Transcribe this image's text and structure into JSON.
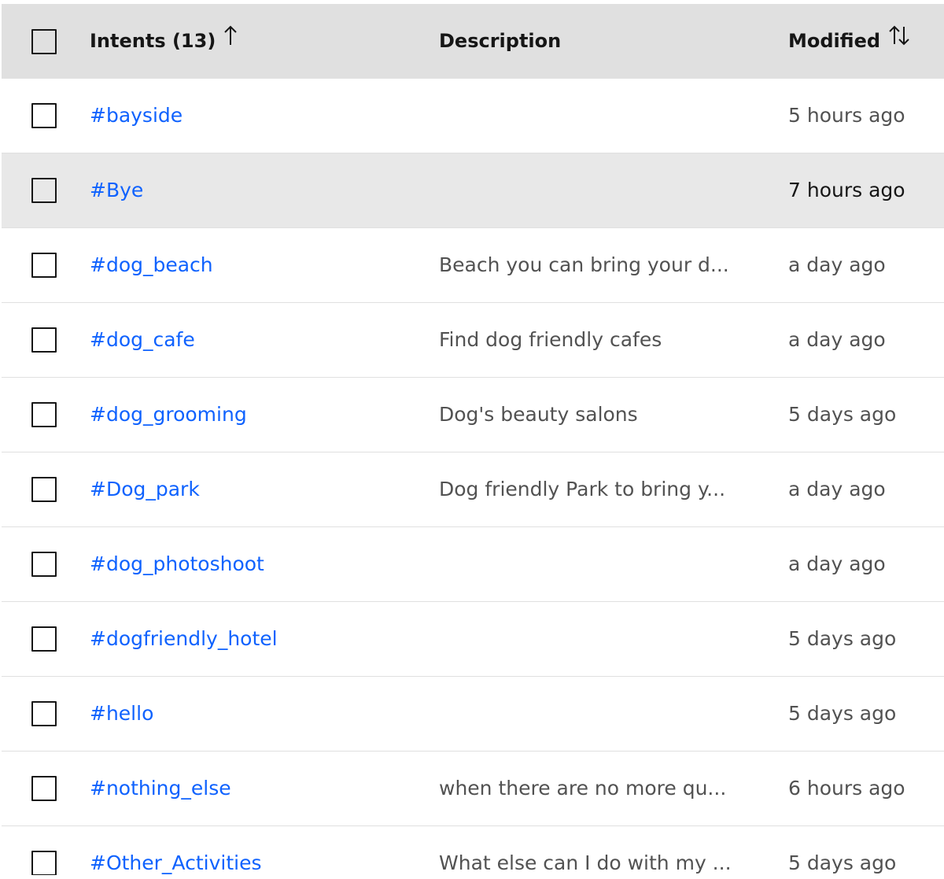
{
  "header": {
    "intents_label": "Intents (13)",
    "description_label": "Description",
    "modified_label": "Modified"
  },
  "rows": [
    {
      "name": "#bayside",
      "description": "",
      "modified": "5 hours ago"
    },
    {
      "name": "#Bye",
      "description": "",
      "modified": "7 hours ago"
    },
    {
      "name": "#dog_beach",
      "description": "Beach you can bring your d...",
      "modified": "a day ago"
    },
    {
      "name": "#dog_cafe",
      "description": "Find dog friendly cafes",
      "modified": "a day ago"
    },
    {
      "name": "#dog_grooming",
      "description": "Dog's beauty salons",
      "modified": "5 days ago"
    },
    {
      "name": "#Dog_park",
      "description": "Dog friendly Park to bring y...",
      "modified": "a day ago"
    },
    {
      "name": "#dog_photoshoot",
      "description": "",
      "modified": "a day ago"
    },
    {
      "name": "#dogfriendly_hotel",
      "description": "",
      "modified": "5 days ago"
    },
    {
      "name": "#hello",
      "description": "",
      "modified": "5 days ago"
    },
    {
      "name": "#nothing_else",
      "description": "when there are no more qu...",
      "modified": "6 hours ago"
    },
    {
      "name": "#Other_Activities",
      "description": "What else can I do with my ...",
      "modified": "5 days ago"
    }
  ],
  "icons": {
    "intents_sort": "arrow-up-icon",
    "modified_sort": "arrows-vertical-icon"
  },
  "colors": {
    "link": "#0f62fe",
    "header_bg": "#e0e0e0",
    "hover_row_bg": "#e8e8e8"
  }
}
